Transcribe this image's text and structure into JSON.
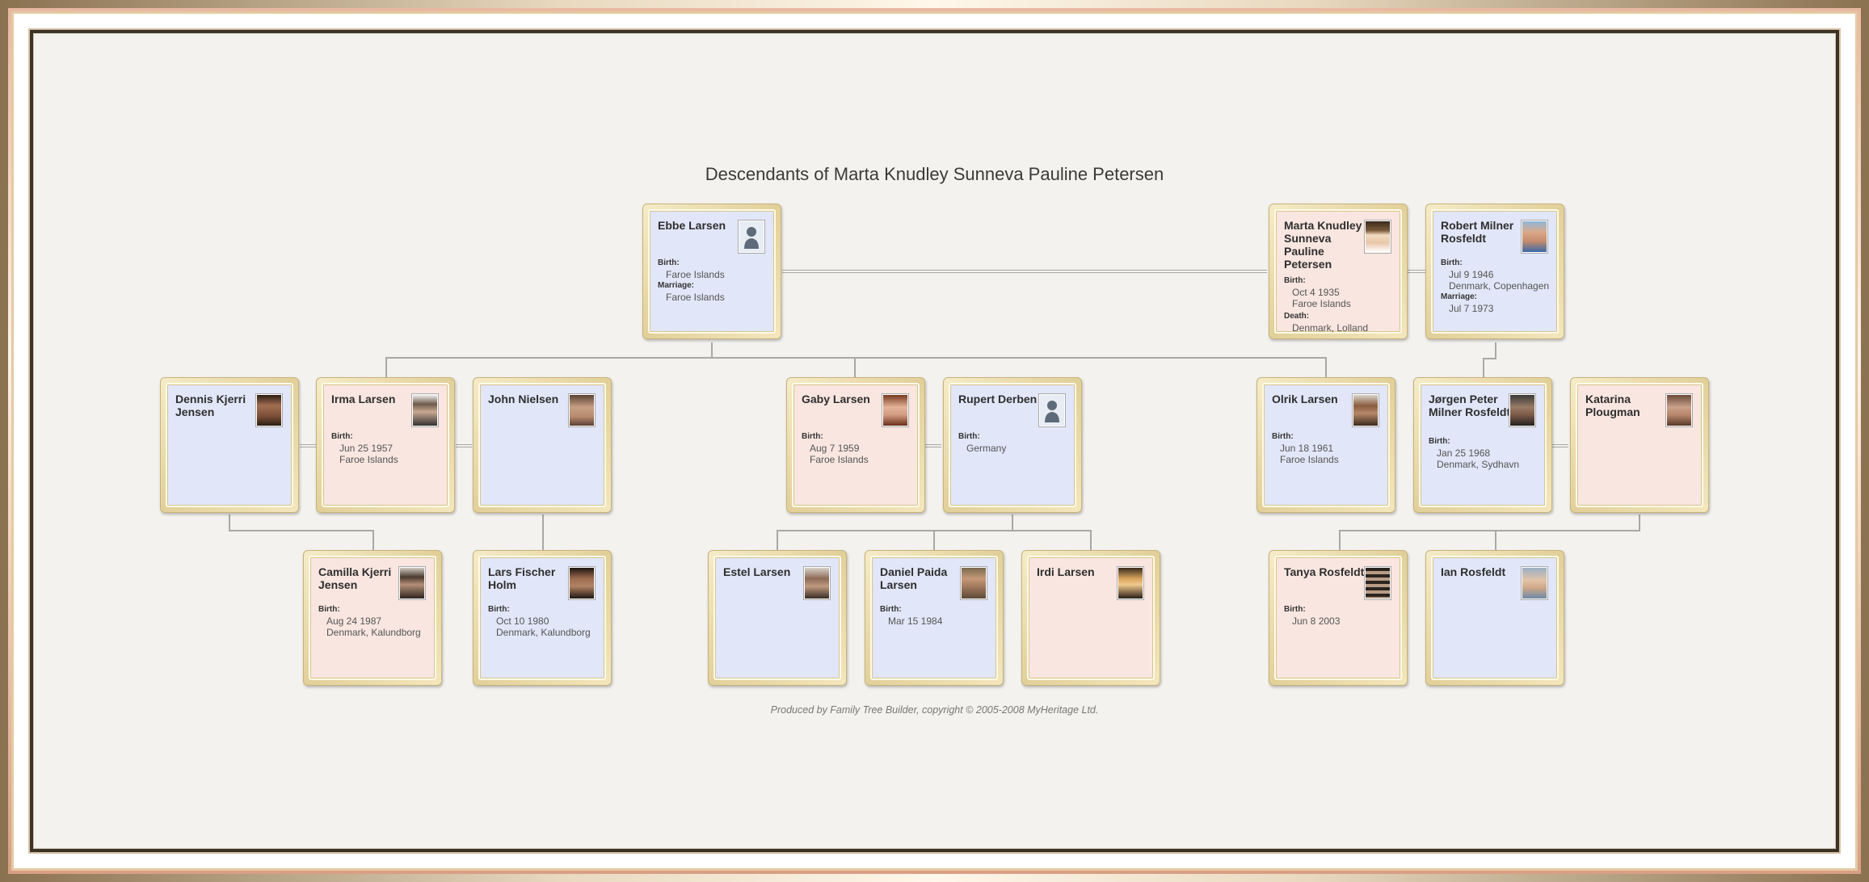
{
  "title": "Descendants of Marta Knudley Sunneva Pauline Petersen",
  "footer": "Produced by Family Tree Builder, copyright © 2005-2008 MyHeritage Ltd.",
  "labels": {
    "birth": "Birth:",
    "marriage": "Marriage:",
    "death": "Death:"
  },
  "people": {
    "ebbe": {
      "name": "Ebbe Larsen",
      "birth_place": "Faroe Islands",
      "marriage_place": "Faroe Islands"
    },
    "marta": {
      "name": "Marta Knudley Sunneva Pauline Petersen",
      "birth_date": "Oct 4 1935",
      "birth_place": "Faroe Islands",
      "death_place": "Denmark, Lolland"
    },
    "robert": {
      "name": "Robert Milner Rosfeldt",
      "birth_date": "Jul 9 1946",
      "birth_place": "Denmark, Copenhagen",
      "marriage_date": "Jul 7 1973"
    },
    "dennis": {
      "name": "Dennis Kjerri Jensen"
    },
    "irma": {
      "name": "Irma Larsen",
      "birth_date": "Jun 25 1957",
      "birth_place": "Faroe Islands"
    },
    "john": {
      "name": "John Nielsen"
    },
    "gaby": {
      "name": "Gaby Larsen",
      "birth_date": "Aug 7 1959",
      "birth_place": "Faroe Islands"
    },
    "rupert": {
      "name": "Rupert Derben",
      "birth_place": "Germany"
    },
    "olrik": {
      "name": "Olrik Larsen",
      "birth_date": "Jun 18 1961",
      "birth_place": "Faroe Islands"
    },
    "jorgen": {
      "name": "Jørgen Peter Milner Rosfeldt",
      "birth_date": "Jan 25 1968",
      "birth_place": "Denmark, Sydhavn"
    },
    "katarina": {
      "name": "Katarina Plougman"
    },
    "camilla": {
      "name": "Camilla Kjerri Jensen",
      "birth_date": "Aug 24 1987",
      "birth_place": "Denmark, Kalundborg"
    },
    "lars": {
      "name": "Lars Fischer Holm",
      "birth_date": "Oct 10 1980",
      "birth_place": "Denmark, Kalundborg"
    },
    "estel": {
      "name": "Estel Larsen"
    },
    "daniel": {
      "name": "Daniel Paida Larsen",
      "birth_date": "Mar 15 1984"
    },
    "irdi": {
      "name": "Irdi Larsen"
    },
    "tanya": {
      "name": "Tanya Rosfeldt",
      "birth_date": "Jun 8 2003"
    },
    "ian": {
      "name": "Ian Rosfeldt"
    }
  },
  "colors": {
    "male_card": "#e1e6f8",
    "female_card": "#f9e6e0",
    "frame_gold": "#e2d09a"
  }
}
